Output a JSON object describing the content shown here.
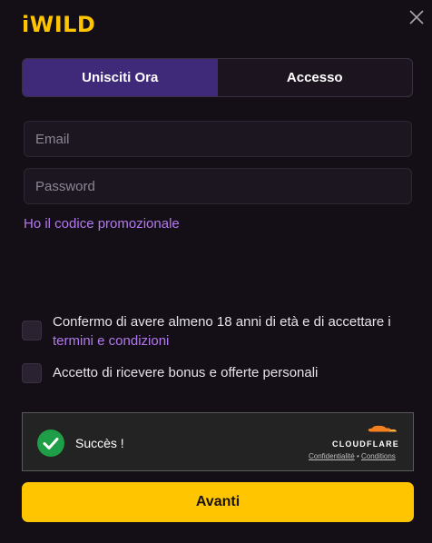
{
  "brand": {
    "logo_text": "iWILD",
    "logo_color": "#ffc400"
  },
  "tabs": [
    {
      "label": "Unisciti Ora",
      "active": true
    },
    {
      "label": "Accesso",
      "active": false
    }
  ],
  "form": {
    "email_placeholder": "Email",
    "email_value": "",
    "password_placeholder": "Password",
    "password_value": "",
    "promo_link": "Ho il codice promozionale"
  },
  "consents": {
    "age_text": "Confermo di avere almeno 18 anni di età e di accettare i",
    "terms_link": "termini e condizioni",
    "age_checked": false,
    "bonus_text": "Accetto di ricevere bonus e offerte personali",
    "bonus_checked": false
  },
  "captcha": {
    "status": "Succès !",
    "brand": "CLOUDFLARE",
    "privacy_link": "Confidentialité",
    "separator": "•",
    "conditions_link": "Conditions"
  },
  "submit_label": "Avanti",
  "colors": {
    "background": "#140f17",
    "accent_purple": "#3f2a7a",
    "link_purple": "#b478f0",
    "button_yellow": "#ffc600",
    "success_green": "#1e9e46",
    "cloudflare_orange": "#f48120"
  },
  "icons": {
    "close": "close-icon",
    "success": "check-circle-icon",
    "cloud": "cloudflare-cloud-icon"
  }
}
